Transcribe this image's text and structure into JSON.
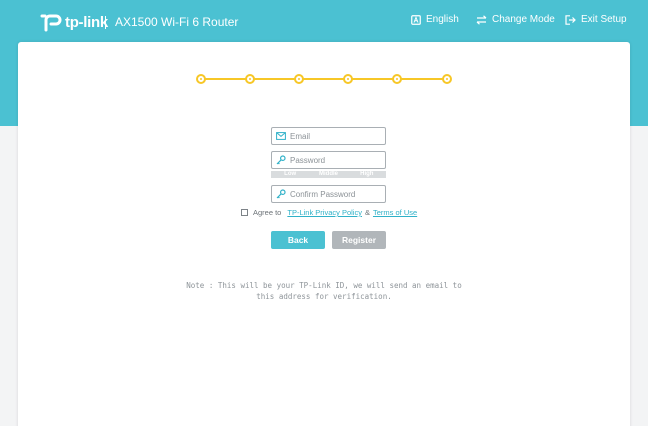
{
  "header": {
    "logo_text": "tp-link",
    "model": "AX1500 Wi-Fi 6 Router",
    "language_label": "English",
    "change_mode_label": "Change Mode",
    "exit_setup_label": "Exit Setup"
  },
  "progress": {
    "total_steps": 6,
    "completed_steps": 6
  },
  "form": {
    "email_placeholder": "Email",
    "password_placeholder": "Password",
    "confirm_placeholder": "Confirm Password",
    "strength_levels": [
      "Low",
      "Middle",
      "High"
    ],
    "agree_prefix": "Agree to",
    "privacy_link": "TP-Link Privacy Policy",
    "amp": "&",
    "terms_link": "Terms of Use",
    "agree_checked": false,
    "back_label": "Back",
    "register_label": "Register"
  },
  "note": "Note : This will be your TP-Link ID, we will send an email to this address for verification.",
  "colors": {
    "brand": "#4bc1d2",
    "progress": "#f7c727",
    "link": "#2fb1c8",
    "disabled_button": "#b1b6ba"
  },
  "icons": {
    "lang": "language-icon",
    "mode": "change-mode-icon",
    "exit": "exit-icon",
    "email": "envelope-icon",
    "password": "key-icon"
  }
}
